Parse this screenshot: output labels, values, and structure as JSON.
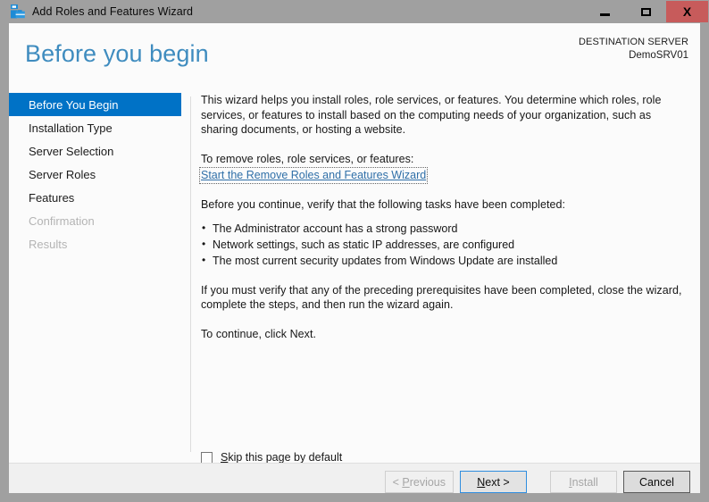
{
  "window": {
    "title": "Add Roles and Features Wizard",
    "icon": "server-wizard-icon",
    "controls": {
      "minimize": "–",
      "maximize": "□",
      "close": "X"
    }
  },
  "header": {
    "page_title": "Before you begin",
    "destination_label": "DESTINATION SERVER",
    "destination_value": "DemoSRV01",
    "accent_color": "#3f8cbf"
  },
  "nav": {
    "items": [
      {
        "label": "Before You Begin",
        "state": "selected"
      },
      {
        "label": "Installation Type",
        "state": "enabled"
      },
      {
        "label": "Server Selection",
        "state": "enabled"
      },
      {
        "label": "Server Roles",
        "state": "enabled"
      },
      {
        "label": "Features",
        "state": "enabled"
      },
      {
        "label": "Confirmation",
        "state": "disabled"
      },
      {
        "label": "Results",
        "state": "disabled"
      }
    ],
    "selected_color": "#0072c6"
  },
  "content": {
    "intro": "This wizard helps you install roles, role services, or features. You determine which roles, role services, or features to install based on the computing needs of your organization, such as sharing documents, or hosting a website.",
    "remove_prompt": "To remove roles, role services, or features:",
    "remove_link": "Start the Remove Roles and Features Wizard",
    "tasks_heading": "Before you continue, verify that the following tasks have been completed:",
    "tasks": [
      "The Administrator account has a strong password",
      "Network settings, such as static IP addresses, are configured",
      "The most current security updates from Windows Update are installed"
    ],
    "verify_note": "If you must verify that any of the preceding prerequisites have been completed, close the wizard, complete the steps, and then run the wizard again.",
    "continue_note": "To continue, click Next."
  },
  "skip": {
    "checked": false,
    "label_accel": "S",
    "label_rest": "kip this page by default"
  },
  "footer": {
    "buttons": [
      {
        "label": "< Previous",
        "accel": "P",
        "state": "disabled"
      },
      {
        "label": "Next >",
        "accel": "N",
        "state": "default"
      },
      {
        "label": "Install",
        "accel": "I",
        "state": "disabled"
      },
      {
        "label": "Cancel",
        "accel": "",
        "state": "hovered"
      }
    ]
  }
}
